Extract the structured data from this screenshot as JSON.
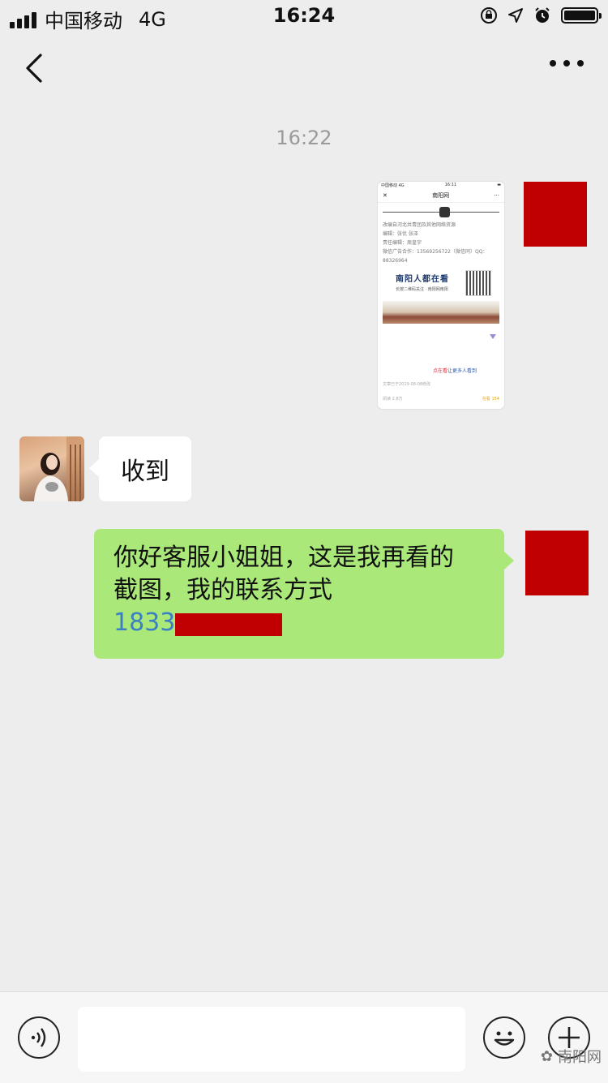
{
  "status_bar": {
    "carrier": "中国移动",
    "network": "4G",
    "time": "16:24"
  },
  "chat": {
    "timestamp": "16:22",
    "shared_screenshot": {
      "mini_status_carrier": "中国移动 4G",
      "mini_status_time": "16:11",
      "mini_title": "南阳网",
      "line1": "改编自河北共青团及其他网络资源",
      "line2": "编辑：张优 张泽",
      "line3": "责任编辑：周皇宇",
      "line4": "微信广告合作：13569256722（微信同）QQ：",
      "line5": "88326964",
      "banner_title": "南阳人都在看",
      "banner_sub": "长按二维码关注 · 南阳网南阳",
      "cta_prefix": "点在",
      "cta_highlight": "看",
      "cta_suffix": "让更多人看到",
      "date": "文章已于2019-08-08修改",
      "reads": "阅读 2.8万",
      "wow": "在看 154"
    },
    "received_message": "收到",
    "sent_message_line1": "你好客服小姐姐，这是我再看的",
    "sent_message_line2": "截图，我的联系方式",
    "sent_phone_visible": "1833"
  },
  "watermark": "南阳网",
  "icons": {
    "back": "chevron-left-icon",
    "more": "more-dots-icon",
    "voice": "voice-icon",
    "emoji": "emoji-icon",
    "plus": "plus-icon"
  }
}
